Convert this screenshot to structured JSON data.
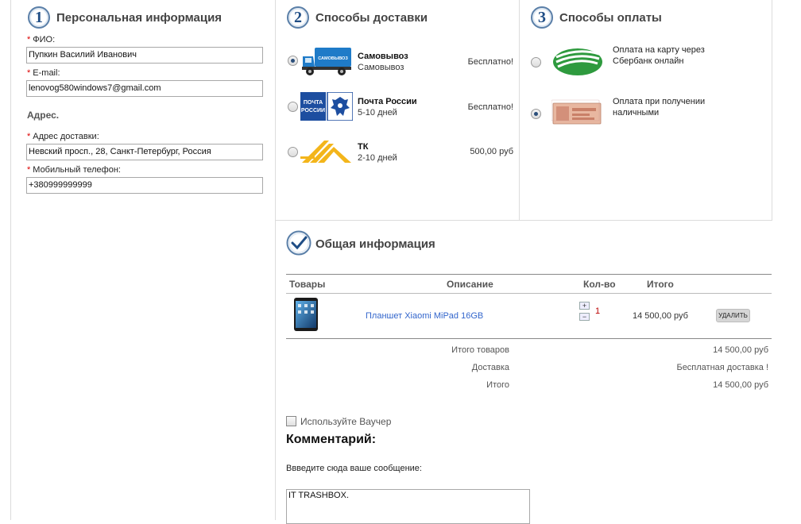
{
  "personal": {
    "step": "1",
    "title": "Персональная информация",
    "required_mark": "*",
    "name_label": "ФИО:",
    "name_value": "Пупкин Василий Иванович",
    "email_label": "E-mail:",
    "email_value": "lenovog580windows7@gmail.com",
    "address_heading": "Адрес.",
    "address_label": "Адрес доставки:",
    "address_value": "Невский просп., 28, Санкт-Петербург, Россия",
    "phone_label": "Мобильный телефон:",
    "phone_value": "+380999999999"
  },
  "shipping": {
    "step": "2",
    "title": "Способы доставки",
    "options": [
      {
        "name": "Самовывоз",
        "sub": "Самовывоз",
        "price": "Бесплатно!",
        "selected": true,
        "icon": "delivery-truck-icon",
        "icon_text": "САМОВЫВОЗ"
      },
      {
        "name": "Почта России",
        "sub": "5-10 дней",
        "price": "Бесплатно!",
        "selected": false,
        "icon": "russian-post-logo",
        "icon_text_top": "ПОЧТА",
        "icon_text_bottom": "РОССИИ"
      },
      {
        "name": "ТК",
        "sub": "2-10 дней",
        "price": "500,00 руб",
        "selected": false,
        "icon": "transport-company-logo"
      }
    ]
  },
  "payment": {
    "step": "3",
    "title": "Способы оплаты",
    "options": [
      {
        "label": "Оплата на карту через Сбербанк онлайн",
        "selected": false,
        "icon": "sberbank-logo"
      },
      {
        "label": "Оплата при получении наличными",
        "selected": true,
        "icon": "banknote-icon"
      }
    ]
  },
  "summary": {
    "title": "Общая информация",
    "columns": {
      "goods": "Товары",
      "description": "Описание",
      "qty": "Кол-во",
      "total": "Итого"
    },
    "item": {
      "name": "Планшет Xiaomi MiPad 16GB",
      "qty": "1",
      "price": "14 500,00 руб",
      "remove_label": "УДАЛИТЬ",
      "plus": "+",
      "minus": "−"
    },
    "goods_total_label": "Итого товаров",
    "goods_total_value": "14 500,00 руб",
    "delivery_label": "Доставка",
    "delivery_value": "Бесплатная доставка !",
    "grand_total_label": "Итого",
    "grand_total_value": "14 500,00 руб"
  },
  "voucher": {
    "label": "Используйте Ваучер"
  },
  "comment": {
    "heading": "Комментарий:",
    "prompt": "Ввведите сюда ваше сообщение:",
    "value": "IT TRASHBOX."
  },
  "colors": {
    "accent_blue": "#1f4d85",
    "link_blue": "#3366cc",
    "required_red": "#dd0000",
    "sber_green": "#2e9a3e",
    "post_blue": "#1d4ea0",
    "tk_yellow": "#f3b51b"
  }
}
